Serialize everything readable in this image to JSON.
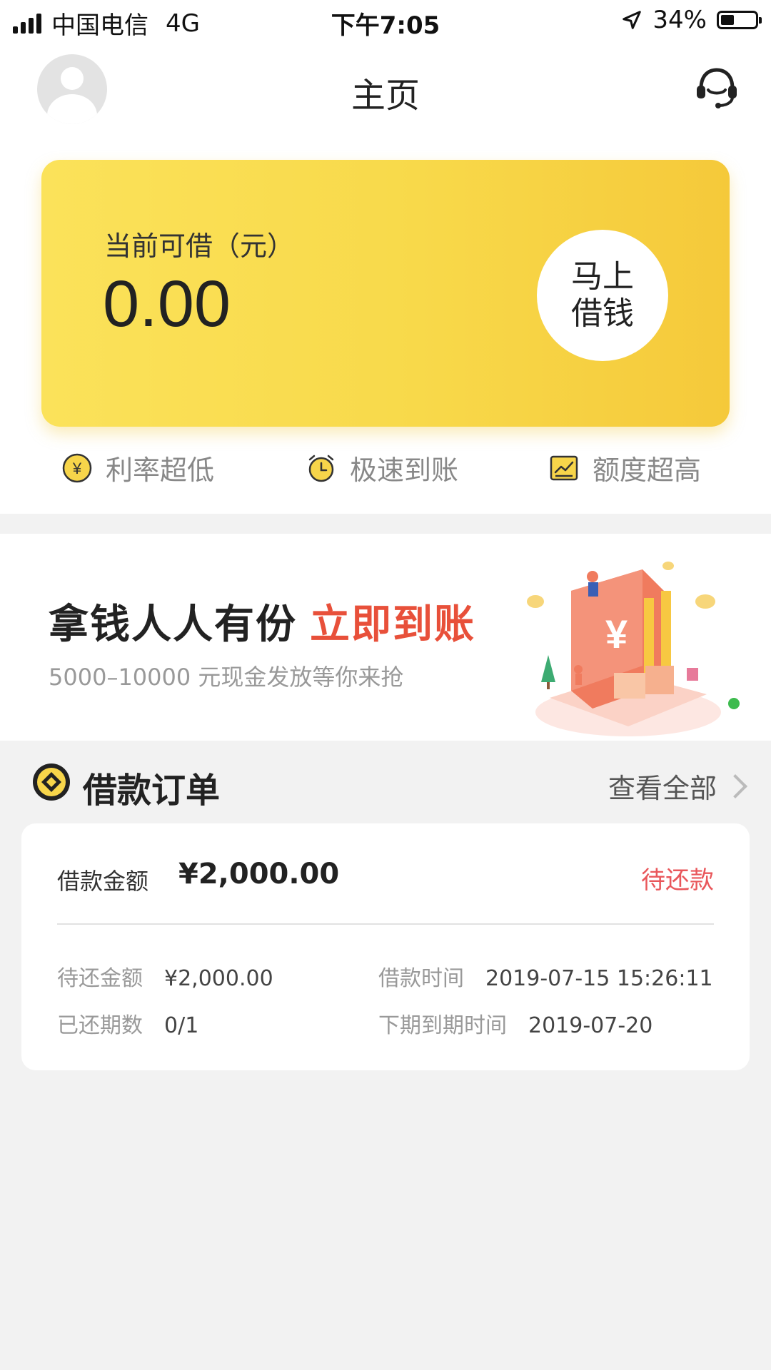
{
  "status_bar": {
    "carrier": "中国电信",
    "network": "4G",
    "time": "下午7:05",
    "battery": "34%",
    "battery_level": 0.34
  },
  "nav": {
    "title": "主页",
    "avatar_icon": "avatar-icon",
    "service_icon": "headset-icon"
  },
  "credit_card": {
    "label": "当前可借（元）",
    "amount": "0.00",
    "button_line1": "马上",
    "button_line2": "借钱"
  },
  "features": [
    {
      "label": "利率超低",
      "icon": "yen-coin-icon"
    },
    {
      "label": "极速到账",
      "icon": "alarm-clock-icon"
    },
    {
      "label": "额度超高",
      "icon": "chart-up-icon"
    }
  ],
  "banner": {
    "title": "拿钱人人有份",
    "highlight": "立即到账",
    "subtitle": "5000–10000 元现金发放等你来抢"
  },
  "orders": {
    "title": "借款订单",
    "view_all": "查看全部",
    "card": {
      "amount_label": "借款金额",
      "amount": "¥2,000.00",
      "status": "待还款",
      "pending_label": "待还金额",
      "pending_value": "¥2,000.00",
      "time_label": "借款时间",
      "time_value": "2019-07-15 15:26:11",
      "paid_label": "已还期数",
      "paid_value": "0/1",
      "due_label": "下期到期时间",
      "due_value": "2019-07-20"
    }
  },
  "colors": {
    "card_yellow": "#f8d94a",
    "status_red": "#e9575b",
    "highlight_red": "#e8503a",
    "dot_green": "#3dbb4e"
  }
}
